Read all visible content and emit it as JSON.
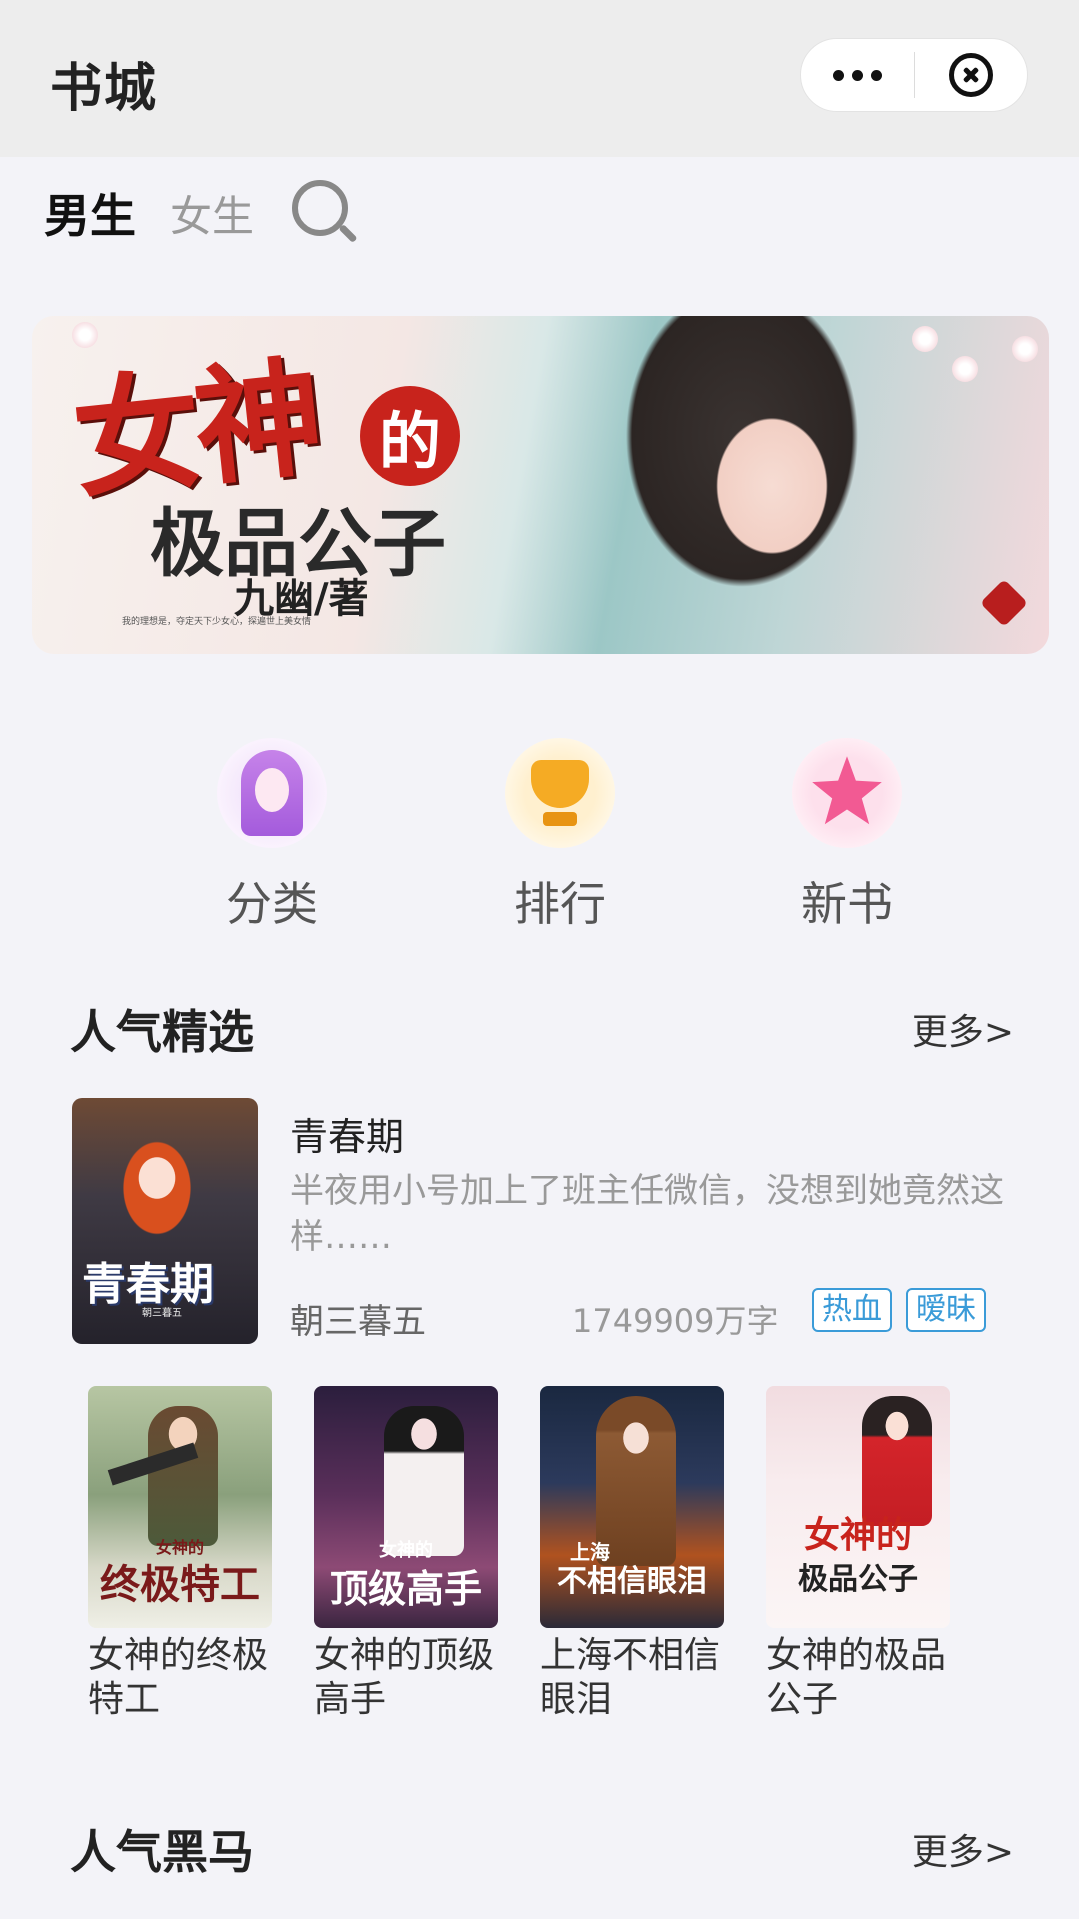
{
  "header": {
    "title": "书城"
  },
  "tabs": [
    {
      "label": "男生",
      "active": true
    },
    {
      "label": "女生",
      "active": false
    }
  ],
  "banner": {
    "title_main": "女神",
    "title_de": "的",
    "title_sub": "极品公子",
    "author": "九幽/著",
    "blurb": "我的理想是，夺定天下少女心，探遍世上美女情"
  },
  "quick_entries": [
    {
      "label": "分类",
      "icon": "girl-avatar-icon"
    },
    {
      "label": "排行",
      "icon": "trophy-icon"
    },
    {
      "label": "新书",
      "icon": "star-icon"
    }
  ],
  "section_popular": {
    "title": "人气精选",
    "more": "更多>"
  },
  "featured": {
    "cover_title": "青春期",
    "cover_author": "朝三暮五",
    "name": "青春期",
    "desc": "半夜用小号加上了班主任微信，没想到她竟然这样……",
    "author": "朝三暮五",
    "words": "1749909万字",
    "tags": [
      "热血",
      "暧昧"
    ]
  },
  "books": [
    {
      "name": "女神的终极特工",
      "cover_text": "终极特工",
      "cover_small": "女神的"
    },
    {
      "name": "女神的顶级高手",
      "cover_text": "顶级高手",
      "cover_small": "女神的"
    },
    {
      "name": "上海不相信眼泪",
      "cover_text": "不相信眼泪",
      "cover_small": "上海"
    },
    {
      "name": "女神的极品公子",
      "cover_text": "极品公子",
      "cover_small": "女神的"
    }
  ],
  "section_darkhorse": {
    "title": "人气黑马",
    "more": "更多>"
  },
  "colors": {
    "background": "#f3f3f8",
    "topbar": "#ededed",
    "tag_blue": "#3a9bd8",
    "accent_red": "#c8231c"
  }
}
